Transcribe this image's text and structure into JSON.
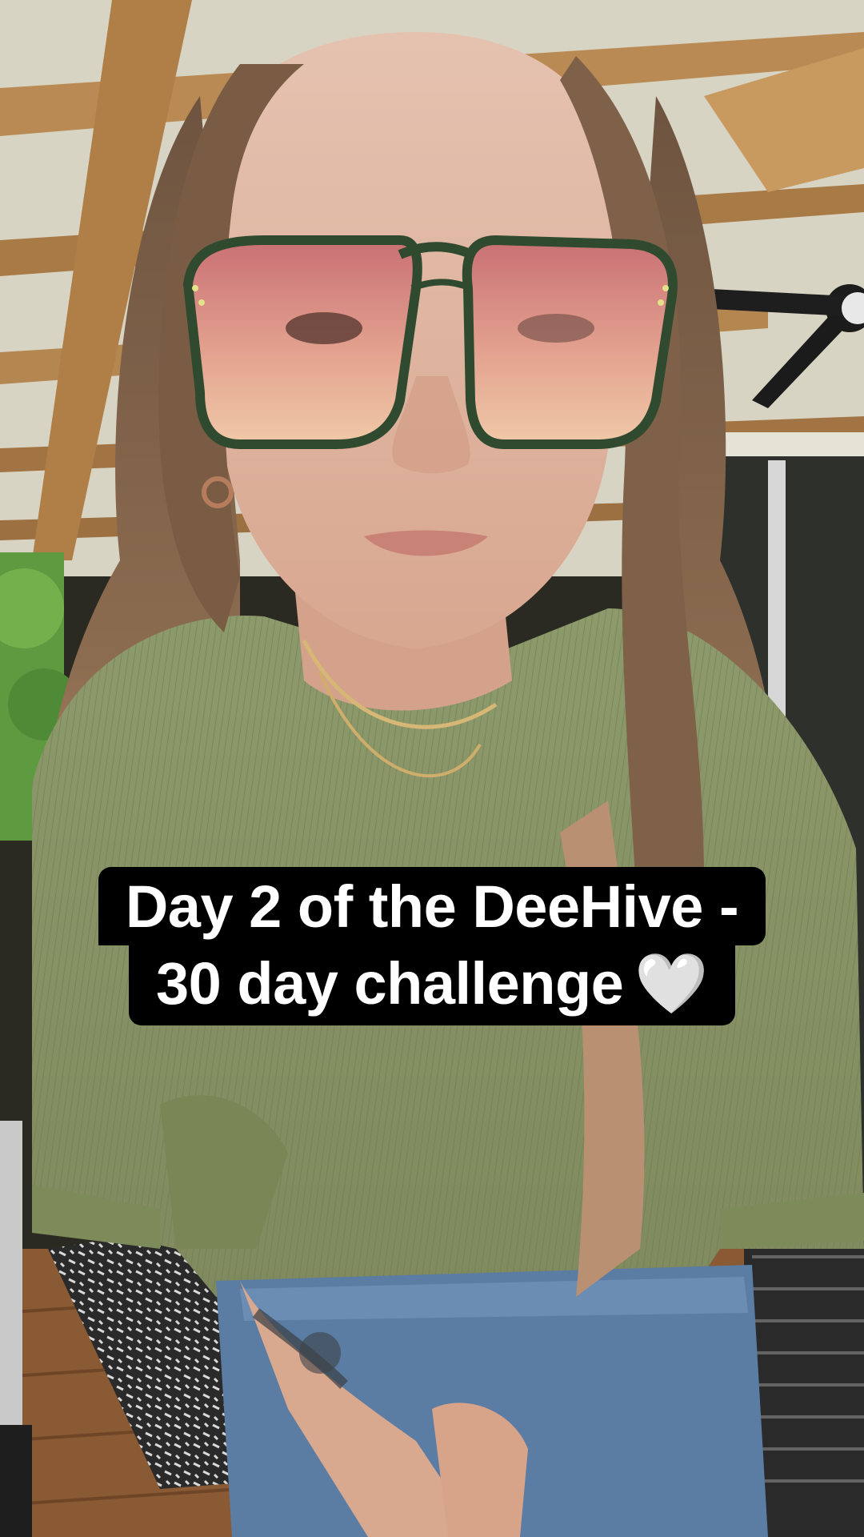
{
  "caption": {
    "line1": "Day 2 of the DeeHive -",
    "line2": "30 day challenge",
    "emoji": "🤍"
  },
  "colors": {
    "caption_bg": "#000000",
    "caption_text": "#ffffff",
    "shirt": "#8a9569",
    "jeans": "#5f7fa6",
    "hair": "#8a6a4e",
    "lens_tint": "#d98a8a",
    "frame": "#2f4a2f",
    "ceiling_wood": "#b8874f",
    "ceiling_panel": "#d9d6c6",
    "foliage": "#5fa042",
    "deck": "#8a5a34",
    "skin": "#dcab94"
  },
  "icons": {
    "ceiling_fan": "ceiling-fan-icon",
    "heart": "white-heart-emoji"
  }
}
